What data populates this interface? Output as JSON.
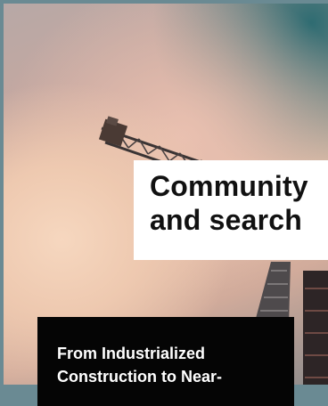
{
  "hero": {
    "image_icon": "construction-crane-image"
  },
  "headline": {
    "lines": [
      "Community",
      "and search"
    ]
  },
  "teaser": {
    "lines": [
      "From Industrialized",
      "Construction to Near-"
    ]
  }
}
